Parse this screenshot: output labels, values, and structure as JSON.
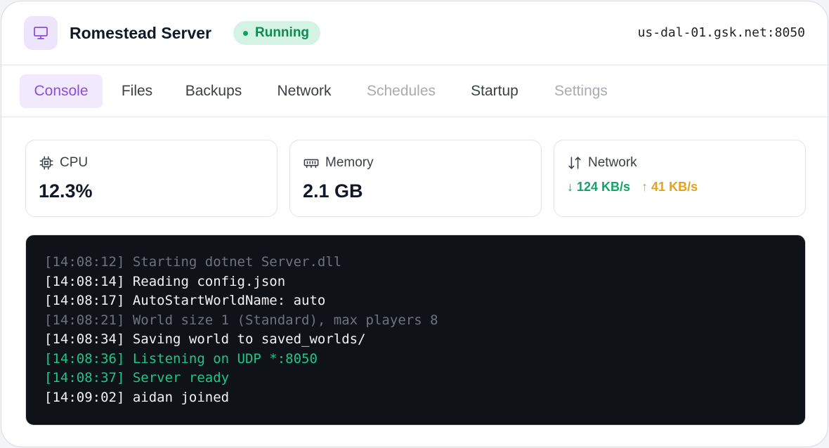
{
  "header": {
    "server_name": "Romestead Server",
    "status": "Running",
    "host": "us-dal-01.gsk.net:8050",
    "icon": "monitor-icon"
  },
  "tabs": [
    {
      "label": "Console",
      "state": "active"
    },
    {
      "label": "Files",
      "state": "normal"
    },
    {
      "label": "Backups",
      "state": "normal"
    },
    {
      "label": "Network",
      "state": "normal"
    },
    {
      "label": "Schedules",
      "state": "disabled"
    },
    {
      "label": "Startup",
      "state": "normal"
    },
    {
      "label": "Settings",
      "state": "disabled"
    }
  ],
  "stats": {
    "cpu": {
      "label": "CPU",
      "value": "12.3%",
      "icon": "cpu-icon"
    },
    "memory": {
      "label": "Memory",
      "value": "2.1 GB",
      "icon": "memory-icon"
    },
    "network": {
      "label": "Network",
      "down": "↓ 124 KB/s",
      "up": "↑ 41 KB/s",
      "icon": "transfer-arrows-icon"
    }
  },
  "console": {
    "lines": [
      {
        "text": "[14:08:12] Starting dotnet Server.dll",
        "tone": "dim"
      },
      {
        "text": "[14:08:14] Reading config.json",
        "tone": "normal"
      },
      {
        "text": "[14:08:17] AutoStartWorldName: auto",
        "tone": "normal"
      },
      {
        "text": "[14:08:21] World size 1 (Standard), max players 8",
        "tone": "dim"
      },
      {
        "text": "[14:08:34] Saving world to saved_worlds/",
        "tone": "normal"
      },
      {
        "text": "[14:08:36] Listening on UDP *:8050",
        "tone": "green"
      },
      {
        "text": "[14:08:37] Server ready",
        "tone": "green"
      },
      {
        "text": "[14:09:02] aidan joined",
        "tone": "normal"
      }
    ]
  },
  "colors": {
    "accent": "#8b4ee0",
    "status_green": "#0d8a55",
    "rate_down": "#12a36a",
    "rate_up": "#e4a11b",
    "console_bg": "#0f1216"
  }
}
